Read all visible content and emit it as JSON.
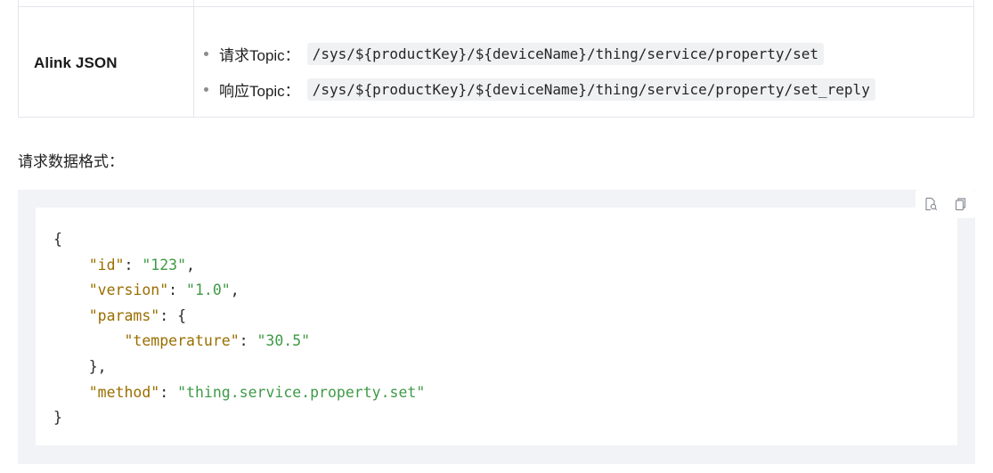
{
  "table": {
    "row_label": "Alink JSON",
    "topics": [
      {
        "label": "请求Topic：",
        "value": "/sys/${productKey}/${deviceName}/thing/service/property/set"
      },
      {
        "label": "响应Topic：",
        "value": "/sys/${productKey}/${deviceName}/thing/service/property/set_reply"
      }
    ]
  },
  "paragraph": "请求数据格式：",
  "code_block": {
    "toolbar": {
      "icons": [
        "search-code-icon",
        "copy-icon"
      ]
    },
    "lines": [
      {
        "indent": "",
        "open": "{",
        "close": ""
      },
      {
        "indent": "    ",
        "key": "\"id\"",
        "sep": ": ",
        "str": "\"123\"",
        "tail": ","
      },
      {
        "indent": "    ",
        "key": "\"version\"",
        "sep": ": ",
        "str": "\"1.0\"",
        "tail": ","
      },
      {
        "indent": "    ",
        "key": "\"params\"",
        "sep": ": ",
        "tail": "{"
      },
      {
        "indent": "        ",
        "key": "\"temperature\"",
        "sep": ": ",
        "str": "\"30.5\"",
        "tail": ""
      },
      {
        "indent": "    ",
        "tail": "},"
      },
      {
        "indent": "    ",
        "key": "\"method\"",
        "sep": ": ",
        "str": "\"thing.service.property.set\"",
        "tail": ""
      },
      {
        "indent": "",
        "tail": "}"
      }
    ]
  },
  "colors": {
    "key": "#9a6e00",
    "string": "#3f9a46",
    "code_bg_outer": "#f1f3f6",
    "inline_code_bg": "#f0f1f3",
    "border": "#e3e6eb"
  }
}
